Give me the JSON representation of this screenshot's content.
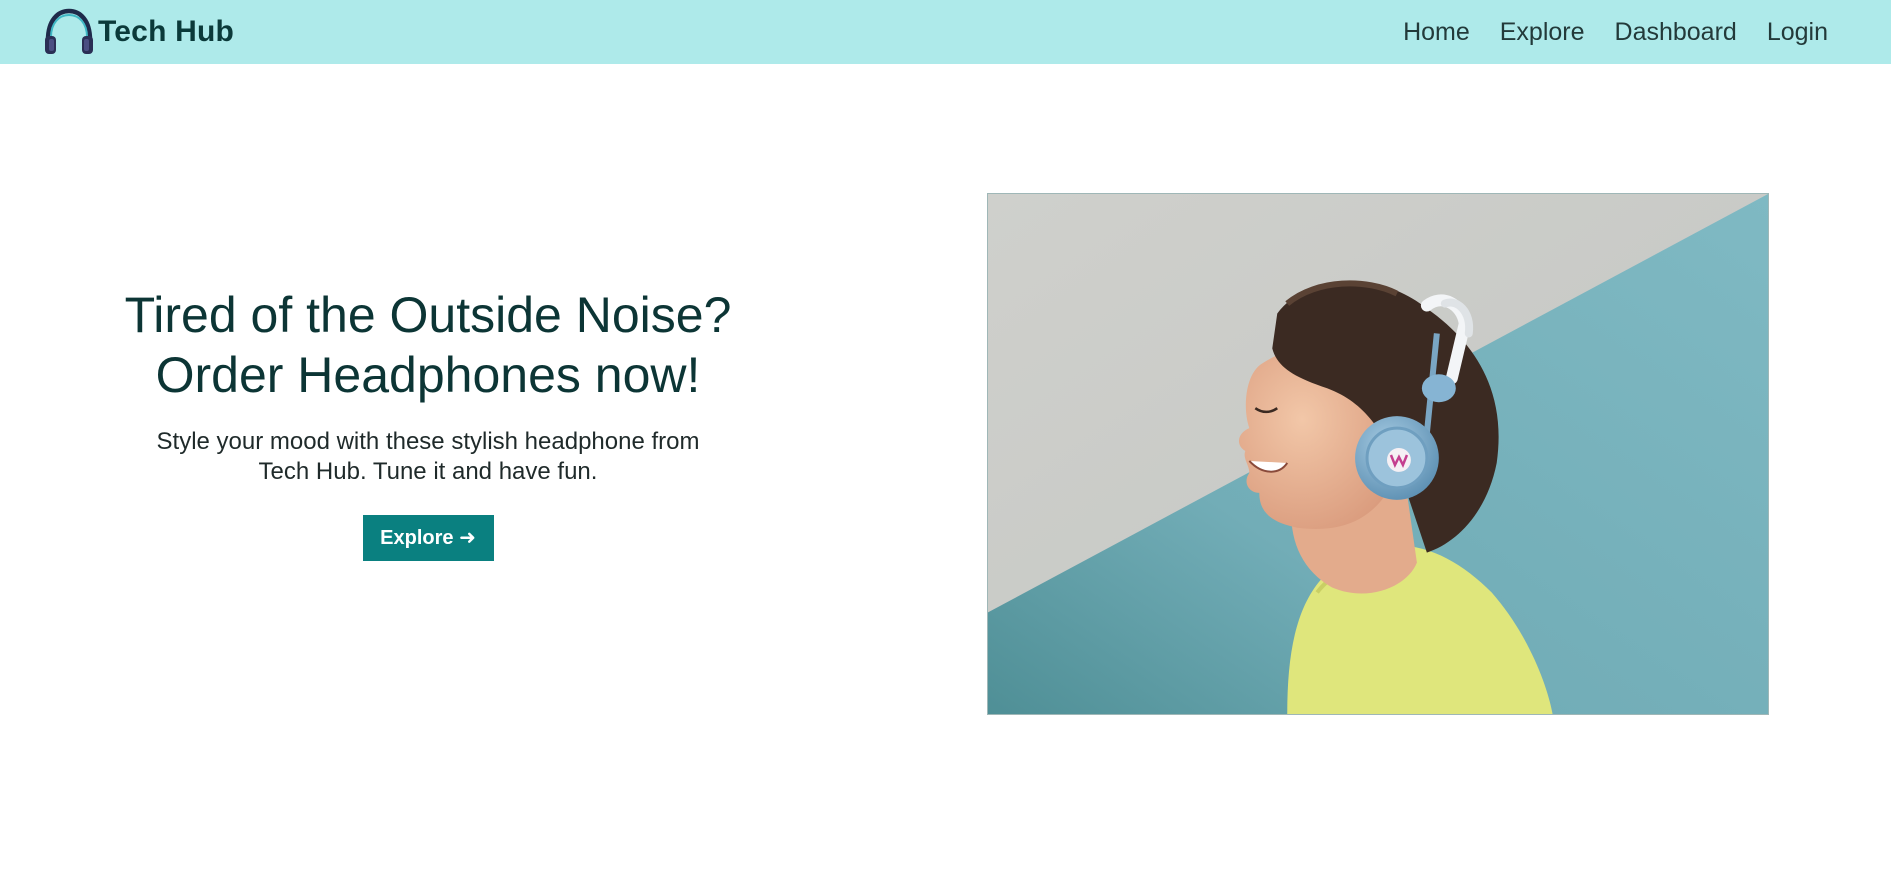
{
  "brand": {
    "name": "Tech Hub",
    "icon": "headphones-icon",
    "color": "#0b3a3a"
  },
  "nav": {
    "items": [
      {
        "label": "Home"
      },
      {
        "label": "Explore"
      },
      {
        "label": "Dashboard"
      },
      {
        "label": "Login"
      }
    ],
    "background": "#aeeaea"
  },
  "hero": {
    "title_line1": "Tired of the Outside Noise?",
    "title_line2": "Order Headphones now!",
    "subtitle": "Style your mood with these stylish headphone from Tech Hub. Tune it and have fun.",
    "button_label": "Explore ➜",
    "button_color": "#0a8080"
  }
}
